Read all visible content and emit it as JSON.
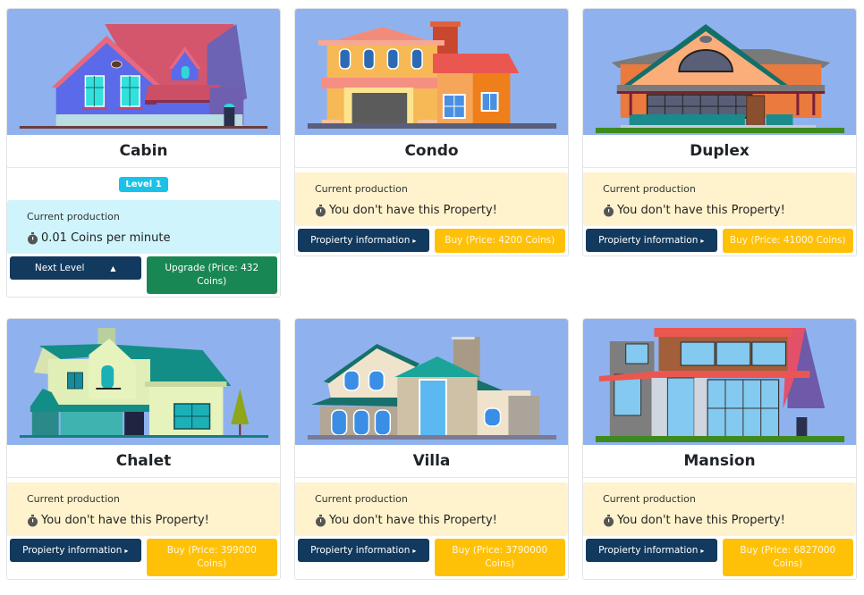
{
  "properties": [
    {
      "name": "Cabin",
      "owned": true,
      "level_badge": "Level 1",
      "production_label": "Current production",
      "production_value": "0.01 Coins per minute",
      "left_button": "Next Level",
      "left_button_icon": "caret-up-icon",
      "right_button": "Upgrade (Price: 432 Coins)",
      "colors": {
        "right_button": "#198754",
        "production_bg": "#cff4fc"
      }
    },
    {
      "name": "Condo",
      "owned": false,
      "production_label": "Current production",
      "production_value": "You don't have this Property!",
      "left_button": "Propierty information",
      "left_button_icon": "caret-right-icon",
      "right_button": "Buy (Price: 4200 Coins)",
      "colors": {
        "right_button": "#ffc107",
        "production_bg": "#fff3cd"
      }
    },
    {
      "name": "Duplex",
      "owned": false,
      "production_label": "Current production",
      "production_value": "You don't have this Property!",
      "left_button": "Propierty information",
      "left_button_icon": "caret-right-icon",
      "right_button": "Buy (Price: 41000 Coins)",
      "colors": {
        "right_button": "#ffc107",
        "production_bg": "#fff3cd"
      }
    },
    {
      "name": "Chalet",
      "owned": false,
      "production_label": "Current production",
      "production_value": "You don't have this Property!",
      "left_button": "Propierty information",
      "left_button_icon": "caret-right-icon",
      "right_button": "Buy (Price: 399000 Coins)",
      "colors": {
        "right_button": "#ffc107",
        "production_bg": "#fff3cd"
      }
    },
    {
      "name": "Villa",
      "owned": false,
      "production_label": "Current production",
      "production_value": "You don't have this Property!",
      "left_button": "Propierty information",
      "left_button_icon": "caret-right-icon",
      "right_button": "Buy (Price: 3790000 Coins)",
      "colors": {
        "right_button": "#ffc107",
        "production_bg": "#fff3cd"
      }
    },
    {
      "name": "Mansion",
      "owned": false,
      "production_label": "Current production",
      "production_value": "You don't have this Property!",
      "left_button": "Propierty information",
      "left_button_icon": "caret-right-icon",
      "right_button": "Buy (Price: 6827000 Coins)",
      "colors": {
        "right_button": "#ffc107",
        "production_bg": "#fff3cd"
      }
    }
  ],
  "theme": {
    "image_bg": "#8fb2ee",
    "dark_button": "#123a5f",
    "badge": "#1bc2e8"
  }
}
